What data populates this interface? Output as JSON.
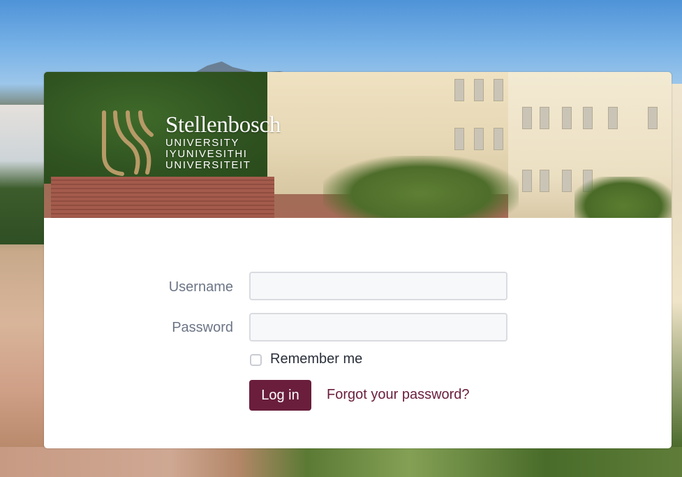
{
  "brand": {
    "name": "Stellenbosch",
    "sub_lines": [
      "UNIVERSITY",
      "IYUNIVESITHI",
      "UNIVERSITEIT"
    ],
    "logo_color": "#b79a67"
  },
  "form": {
    "username_label": "Username",
    "username_value": "",
    "password_label": "Password",
    "password_value": "",
    "remember_label": "Remember me",
    "remember_checked": false,
    "login_button": "Log in",
    "forgot_link": "Forgot your password?"
  },
  "colors": {
    "accent": "#6a1e3c",
    "label": "#6c7585",
    "input_bg": "#f7f8fa",
    "input_border": "#d9dbe0"
  },
  "icons": {
    "logo": "stellenbosch-logo-icon",
    "checkbox": "checkbox-icon"
  }
}
